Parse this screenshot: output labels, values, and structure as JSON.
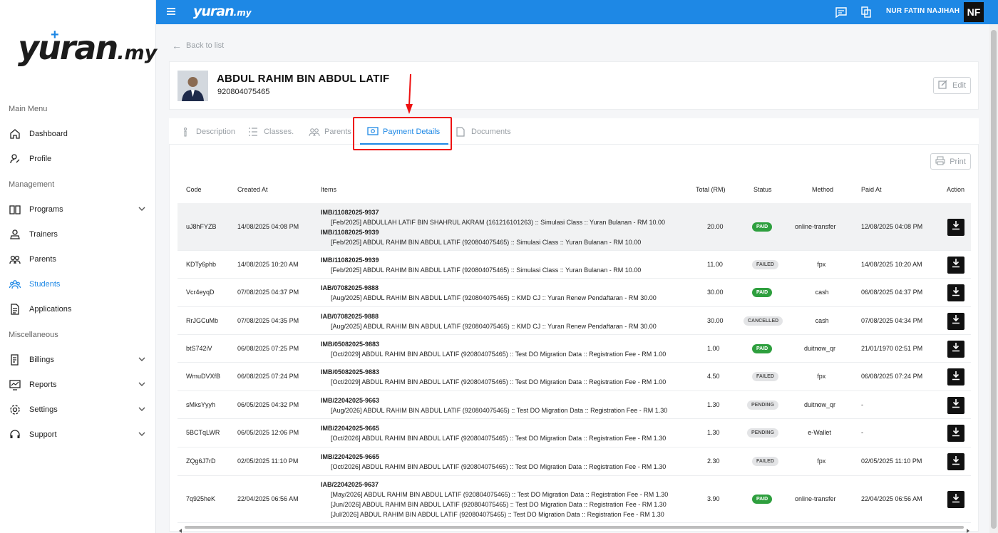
{
  "app": {
    "logo_main": "yuran",
    "logo_tld": ".my",
    "top_logo_main": "yuran",
    "top_logo_tld": ".my"
  },
  "user": {
    "name": "NUR FATIN NAJIHAH",
    "initials": "NF"
  },
  "sidebar": {
    "sections": [
      "Main Menu",
      "Management",
      "Miscellaneous"
    ],
    "items": [
      {
        "label": "Dashboard",
        "icon": "home-icon"
      },
      {
        "label": "Profile",
        "icon": "profile-icon"
      },
      {
        "label": "Programs",
        "icon": "book-icon"
      },
      {
        "label": "Trainers",
        "icon": "trainer-icon"
      },
      {
        "label": "Parents",
        "icon": "parents-icon"
      },
      {
        "label": "Students",
        "icon": "students-icon"
      },
      {
        "label": "Applications",
        "icon": "document-icon"
      },
      {
        "label": "Billings",
        "icon": "billing-icon"
      },
      {
        "label": "Reports",
        "icon": "reports-icon"
      },
      {
        "label": "Settings",
        "icon": "gear-icon"
      },
      {
        "label": "Support",
        "icon": "headset-icon"
      }
    ]
  },
  "page": {
    "back_label": "Back to list",
    "student_name": "ABDUL RAHIM BIN ABDUL LATIF",
    "student_ic": "920804075465",
    "edit_label": "Edit",
    "print_label": "Print",
    "tabs": [
      "Description",
      "Classes.",
      "Parents",
      "Payment Details",
      "Documents"
    ],
    "active_tab": "Payment Details"
  },
  "table": {
    "headers": [
      "Code",
      "Created At",
      "Items",
      "Total (RM)",
      "Status",
      "Method",
      "Paid At",
      "Action"
    ],
    "rows": [
      {
        "code": "uJ8hFYZB",
        "created": "14/08/2025 04:08 PM",
        "items": [
          {
            "ref": "IMB/11082025-9937",
            "desc": "[Feb/2025] ABDULLAH LATIF BIN SHAHRUL AKRAM (161216101263) :: Simulasi Class :: Yuran Bulanan - RM 10.00"
          },
          {
            "ref": "IMB/11082025-9939",
            "desc": "[Feb/2025] ABDUL RAHIM BIN ABDUL LATIF (920804075465) :: Simulasi Class :: Yuran Bulanan - RM 10.00"
          }
        ],
        "total": "20.00",
        "status": "PAID",
        "method": "online-transfer",
        "paid": "12/08/2025 04:08 PM"
      },
      {
        "code": "KDTy6phb",
        "created": "14/08/2025 10:20 AM",
        "items": [
          {
            "ref": "IMB/11082025-9939",
            "desc": "[Feb/2025] ABDUL RAHIM BIN ABDUL LATIF (920804075465) :: Simulasi Class :: Yuran Bulanan - RM 10.00"
          }
        ],
        "total": "11.00",
        "status": "FAILED",
        "method": "fpx",
        "paid": "14/08/2025 10:20 AM"
      },
      {
        "code": "Vcr4eyqD",
        "created": "07/08/2025 04:37 PM",
        "items": [
          {
            "ref": "IAB/07082025-9888",
            "desc": "[Aug/2025] ABDUL RAHIM BIN ABDUL LATIF (920804075465) :: KMD CJ :: Yuran Renew Pendaftaran - RM 30.00"
          }
        ],
        "total": "30.00",
        "status": "PAID",
        "method": "cash",
        "paid": "06/08/2025 04:37 PM"
      },
      {
        "code": "RrJGCuMb",
        "created": "07/08/2025 04:35 PM",
        "items": [
          {
            "ref": "IAB/07082025-9888",
            "desc": "[Aug/2025] ABDUL RAHIM BIN ABDUL LATIF (920804075465) :: KMD CJ :: Yuran Renew Pendaftaran - RM 30.00"
          }
        ],
        "total": "30.00",
        "status": "CANCELLED",
        "method": "cash",
        "paid": "07/08/2025 04:34 PM"
      },
      {
        "code": "btS742iV",
        "created": "06/08/2025 07:25 PM",
        "items": [
          {
            "ref": "IMB/05082025-9883",
            "desc": "[Oct/2029] ABDUL RAHIM BIN ABDUL LATIF (920804075465) :: Test DO Migration Data :: Registration Fee - RM 1.00"
          }
        ],
        "total": "1.00",
        "status": "PAID",
        "method": "duitnow_qr",
        "paid": "21/01/1970 02:51 PM"
      },
      {
        "code": "WmuDVXfB",
        "created": "06/08/2025 07:24 PM",
        "items": [
          {
            "ref": "IMB/05082025-9883",
            "desc": "[Oct/2029] ABDUL RAHIM BIN ABDUL LATIF (920804075465) :: Test DO Migration Data :: Registration Fee - RM 1.00"
          }
        ],
        "total": "4.50",
        "status": "FAILED",
        "method": "fpx",
        "paid": "06/08/2025 07:24 PM"
      },
      {
        "code": "sMksYyyh",
        "created": "06/05/2025 04:32 PM",
        "items": [
          {
            "ref": "IMB/22042025-9663",
            "desc": "[Aug/2026] ABDUL RAHIM BIN ABDUL LATIF (920804075465) :: Test DO Migration Data :: Registration Fee - RM 1.30"
          }
        ],
        "total": "1.30",
        "status": "PENDING",
        "method": "duitnow_qr",
        "paid": "-"
      },
      {
        "code": "5BCTqLWR",
        "created": "06/05/2025 12:06 PM",
        "items": [
          {
            "ref": "IMB/22042025-9665",
            "desc": "[Oct/2026] ABDUL RAHIM BIN ABDUL LATIF (920804075465) :: Test DO Migration Data :: Registration Fee - RM 1.30"
          }
        ],
        "total": "1.30",
        "status": "PENDING",
        "method": "e-Wallet",
        "paid": "-"
      },
      {
        "code": "ZQg6J7rD",
        "created": "02/05/2025 11:10 PM",
        "items": [
          {
            "ref": "IMB/22042025-9665",
            "desc": "[Oct/2026] ABDUL RAHIM BIN ABDUL LATIF (920804075465) :: Test DO Migration Data :: Registration Fee - RM 1.30"
          }
        ],
        "total": "2.30",
        "status": "FAILED",
        "method": "fpx",
        "paid": "02/05/2025 11:10 PM"
      },
      {
        "code": "7q925heK",
        "created": "22/04/2025 06:56 AM",
        "items": [
          {
            "ref": "IAB/22042025-9637",
            "desc": "[May/2026] ABDUL RAHIM BIN ABDUL LATIF (920804075465) :: Test DO Migration Data :: Registration Fee - RM 1.30"
          },
          {
            "ref": "",
            "desc": "[Jun/2026] ABDUL RAHIM BIN ABDUL LATIF (920804075465) :: Test DO Migration Data :: Registration Fee - RM 1.30"
          },
          {
            "ref": "",
            "desc": "[Jul/2026] ABDUL RAHIM BIN ABDUL LATIF (920804075465) :: Test DO Migration Data :: Registration Fee - RM 1.30"
          }
        ],
        "total": "3.90",
        "status": "PAID",
        "method": "online-transfer",
        "paid": "22/04/2025 06:56 AM"
      }
    ]
  },
  "colors": {
    "primary": "#1e88e5",
    "paid": "#2e9f3e",
    "highlight": "#ee1111"
  }
}
